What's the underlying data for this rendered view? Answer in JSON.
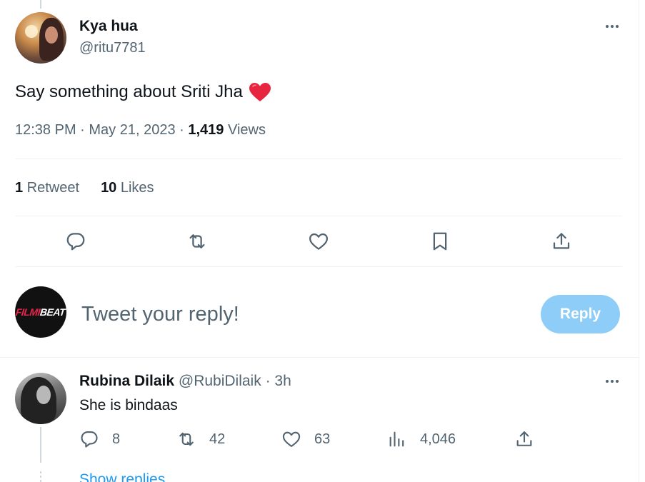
{
  "tweet": {
    "author_name": "Kya hua",
    "author_handle": "@ritu7781",
    "text": "Say something about Sriti Jha",
    "emoji": "red-heart",
    "time": "12:38 PM · May 21, 2023 · ",
    "views_count": "1,419",
    "views_label": " Views",
    "retweets_count": "1",
    "retweets_label": " Retweet",
    "likes_count": "10",
    "likes_label": " Likes"
  },
  "actions": [
    {
      "icon": "reply-icon"
    },
    {
      "icon": "retweet-icon"
    },
    {
      "icon": "like-icon"
    },
    {
      "icon": "bookmark-icon"
    },
    {
      "icon": "share-icon"
    }
  ],
  "composer": {
    "avatar_brand_1": "FILMI",
    "avatar_brand_2": "BEAT",
    "placeholder": "Tweet your reply!",
    "button_label": "Reply",
    "button_color": "#8ecdf7"
  },
  "reply": {
    "author_name": "Rubina Dilaik",
    "author_handle": "@RubiDilaik",
    "time": " · 3h",
    "text": "She is bindaas",
    "replies": "8",
    "retweets": "42",
    "likes": "63",
    "views": "4,046",
    "show_replies": "Show replies"
  },
  "colors": {
    "text_primary": "#0f1419",
    "text_secondary": "#536471",
    "accent": "#1d9bf0",
    "heart": "#e8253f"
  }
}
